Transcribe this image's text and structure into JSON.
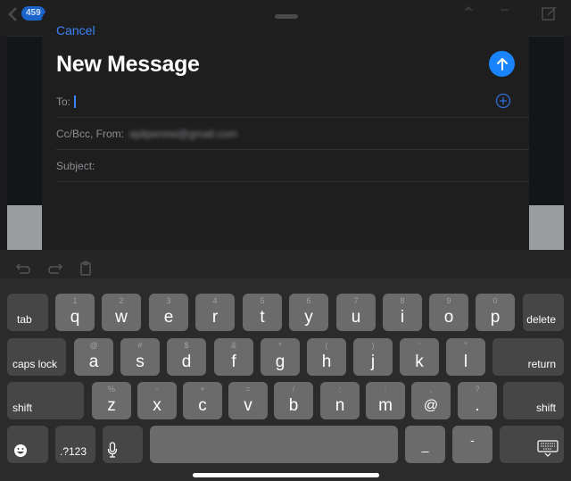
{
  "background": {
    "back_badge": "459",
    "icons": [
      "back-chevron-icon",
      "share-icon",
      "folder-icon",
      "compose-icon"
    ]
  },
  "compose": {
    "cancel_label": "Cancel",
    "title": "New Message",
    "send_icon": "arrow-up-icon",
    "fields": {
      "to_label": "To:",
      "to_value": "",
      "cc_label": "Cc/Bcc, From:",
      "from_value": "aplipenew@gmail.com",
      "subject_label": "Subject:",
      "subject_value": ""
    },
    "add_contact_icon": "plus-circle-icon"
  },
  "shortcut_bar": {
    "icons": [
      "undo-icon",
      "redo-icon",
      "paste-icon"
    ]
  },
  "keyboard": {
    "row1": [
      {
        "main": "q",
        "sec": "1"
      },
      {
        "main": "w",
        "sec": "2"
      },
      {
        "main": "e",
        "sec": "3"
      },
      {
        "main": "r",
        "sec": "4"
      },
      {
        "main": "t",
        "sec": "5"
      },
      {
        "main": "y",
        "sec": "6"
      },
      {
        "main": "u",
        "sec": "7"
      },
      {
        "main": "i",
        "sec": "8"
      },
      {
        "main": "o",
        "sec": "9"
      },
      {
        "main": "p",
        "sec": "0"
      }
    ],
    "row2": [
      {
        "main": "a",
        "sec": "@"
      },
      {
        "main": "s",
        "sec": "#"
      },
      {
        "main": "d",
        "sec": "$"
      },
      {
        "main": "f",
        "sec": "&"
      },
      {
        "main": "g",
        "sec": "*"
      },
      {
        "main": "h",
        "sec": "("
      },
      {
        "main": "j",
        "sec": ")"
      },
      {
        "main": "k",
        "sec": "'"
      },
      {
        "main": "l",
        "sec": "\""
      }
    ],
    "row3": [
      {
        "main": "z",
        "sec": "%"
      },
      {
        "main": "x",
        "sec": "-"
      },
      {
        "main": "c",
        "sec": "+"
      },
      {
        "main": "v",
        "sec": "="
      },
      {
        "main": "b",
        "sec": "/"
      },
      {
        "main": "n",
        "sec": ";"
      },
      {
        "main": "m",
        "sec": ":"
      },
      {
        "main": "@",
        "sec": ","
      },
      {
        "main": ".",
        "sec": "?"
      }
    ],
    "tab": "tab",
    "delete": "delete",
    "caps_lock": "caps lock",
    "return": "return",
    "shift": "shift",
    "numbers": ".?123",
    "underscore": "_",
    "dash": "-",
    "emoji_icon": "emoji-icon",
    "mic_icon": "microphone-icon",
    "dismiss_icon": "keyboard-dismiss-icon"
  }
}
